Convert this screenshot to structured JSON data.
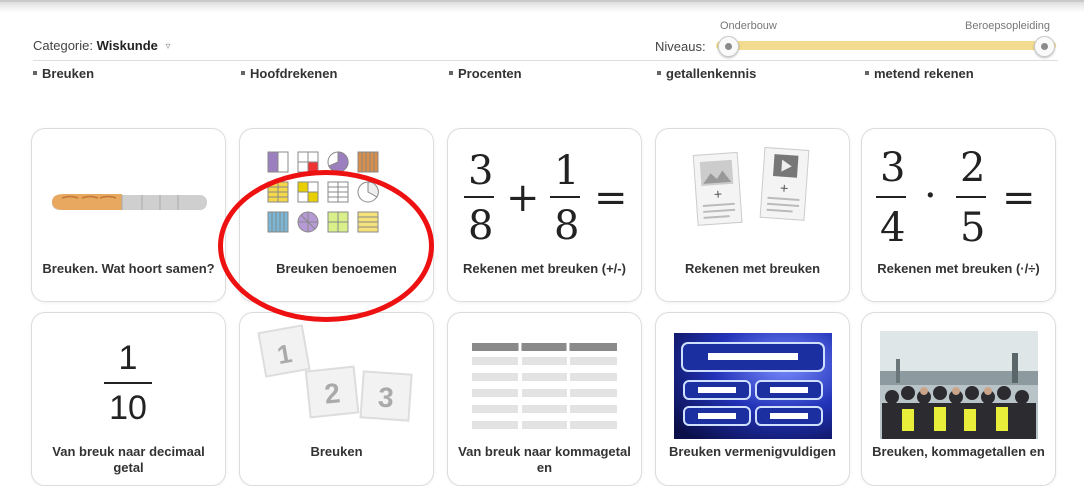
{
  "header": {
    "category_prefix": "Categorie:",
    "category_value": "Wiskunde",
    "category_chevron": "▿",
    "levels_label": "Niveaus:",
    "level_low": "Onderbouw",
    "level_high": "Beroepsopleiding"
  },
  "subcategories": [
    "Breuken",
    "Hoofdrekenen",
    "Procenten",
    "getallenkennis",
    "metend rekenen"
  ],
  "cards": {
    "c1": "Breuken. Wat hoort samen?",
    "c2": "Breuken benoemen",
    "c3": "Rekenen met breuken (+/-)",
    "c4": "Rekenen met breuken",
    "c5": "Rekenen met breuken (·/÷)",
    "c6": "Van breuk naar decimaal getal",
    "c7": "Breuken",
    "c8": "Van breuk naar kommagetal en",
    "c9": "Breuken vermenigvuldigen",
    "c10": "Breuken, kommagetallen en"
  },
  "art": {
    "frac_add": {
      "n1": "3",
      "d1": "8",
      "op": "+",
      "n2": "1",
      "d2": "8",
      "eq": "="
    },
    "frac_mul": {
      "n1": "3",
      "d1": "4",
      "op": "·",
      "n2": "2",
      "d2": "5",
      "eq": "="
    },
    "frac_dec": {
      "n": "1",
      "d": "10"
    },
    "numbers": [
      "1",
      "2",
      "3"
    ],
    "plus": "+"
  },
  "colors": {
    "highlight_circle": "#e11111",
    "slider_track": "#f3dc8f",
    "quiz_blue": "#1a2cc8"
  }
}
